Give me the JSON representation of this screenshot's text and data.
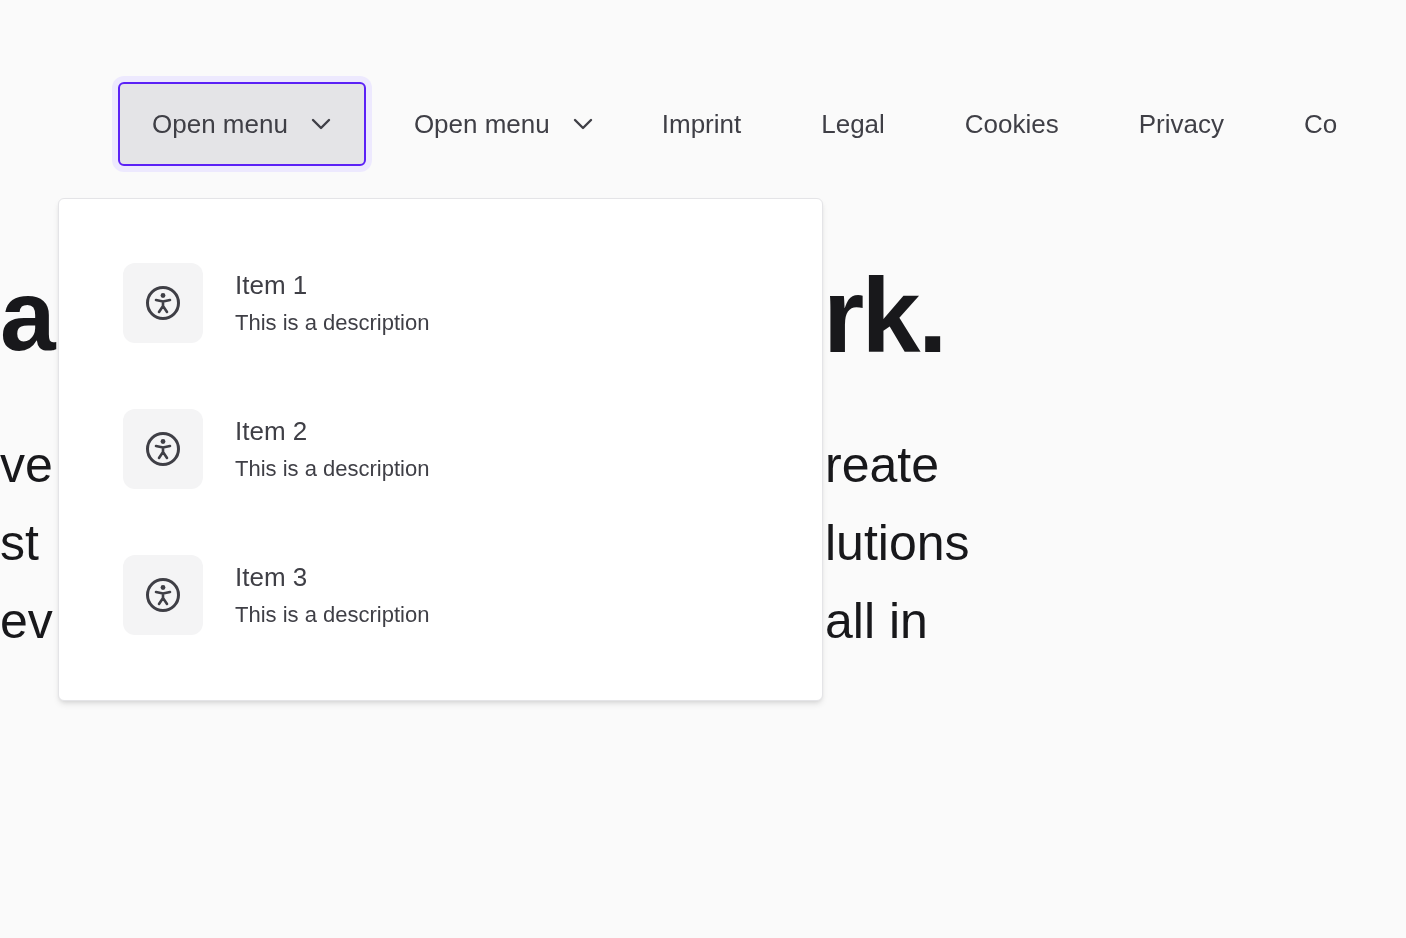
{
  "nav": [
    {
      "kind": "dropdown",
      "label": "Open menu",
      "selected": true
    },
    {
      "kind": "dropdown",
      "label": "Open menu",
      "selected": false
    },
    {
      "kind": "link",
      "label": "Imprint",
      "selected": false
    },
    {
      "kind": "link",
      "label": "Legal",
      "selected": false
    },
    {
      "kind": "link",
      "label": "Cookies",
      "selected": false
    },
    {
      "kind": "link",
      "label": "Privacy",
      "selected": false
    },
    {
      "kind": "link",
      "label": "Co",
      "selected": false
    }
  ],
  "menu": {
    "items": [
      {
        "title": "Item 1",
        "description": "This is a description"
      },
      {
        "title": "Item 2",
        "description": "This is a description"
      },
      {
        "title": "Item 3",
        "description": "This is a description"
      }
    ]
  },
  "hero": {
    "heading_left": "a",
    "heading_right": "rk.",
    "paragraph_left": [
      "ve",
      "st",
      "ev"
    ],
    "paragraph_right": [
      "reate",
      "lutions",
      "all in"
    ]
  }
}
